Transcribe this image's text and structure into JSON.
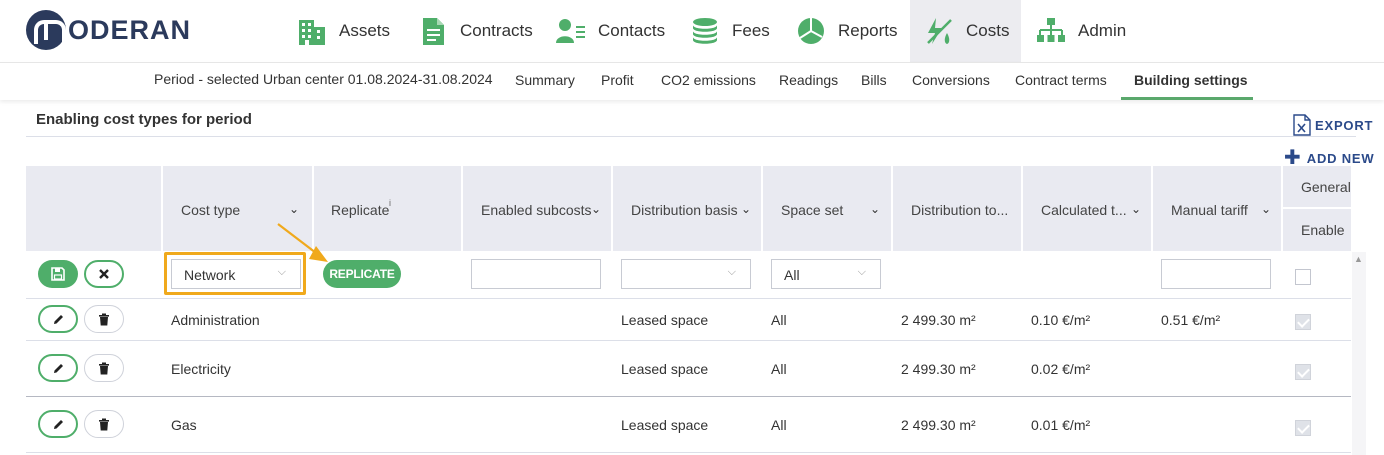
{
  "brand": {
    "logo_text": "ODERAN"
  },
  "nav": {
    "items": [
      {
        "label": "Assets",
        "icon": "building-icon"
      },
      {
        "label": "Contracts",
        "icon": "document-icon"
      },
      {
        "label": "Contacts",
        "icon": "contacts-icon"
      },
      {
        "label": "Fees",
        "icon": "coins-icon"
      },
      {
        "label": "Reports",
        "icon": "pie-chart-icon"
      },
      {
        "label": "Costs",
        "icon": "costs-icon",
        "active": true
      },
      {
        "label": "Admin",
        "icon": "org-chart-icon"
      }
    ]
  },
  "subnav": {
    "period": "Period - selected Urban center 01.08.2024-31.08.2024",
    "tabs": [
      {
        "label": "Summary"
      },
      {
        "label": "Profit"
      },
      {
        "label": "CO2 emissions"
      },
      {
        "label": "Readings"
      },
      {
        "label": "Bills"
      },
      {
        "label": "Conversions"
      },
      {
        "label": "Contract terms"
      },
      {
        "label": "Building settings",
        "active": true
      }
    ]
  },
  "section": {
    "title": "Enabling cost types for period",
    "export_label": "EXPORT",
    "add_new_label": "ADD NEW"
  },
  "table": {
    "columns": {
      "cost_type": "Cost type",
      "replicate": "Replicate",
      "replicate_info": "i",
      "enabled_subcosts": "Enabled subcosts",
      "distribution_basis": "Distribution basis",
      "space_set": "Space set",
      "distribution_total": "Distribution to...",
      "calculated_tariff": "Calculated t...",
      "manual_tariff": "Manual tariff",
      "general": "General",
      "enable": "Enable"
    },
    "edit_row": {
      "cost_type_value": "Network",
      "replicate_button": "REPLICATE",
      "enabled_subcosts_value": "",
      "distribution_basis_value": "",
      "space_set_value": "All",
      "manual_tariff_value": "",
      "enable_checked": false
    },
    "rows": [
      {
        "cost_type": "Administration",
        "distribution_basis": "Leased space",
        "space_set": "All",
        "distribution_total": "2 499.30 m²",
        "calculated_tariff": "0.10 €/m²",
        "manual_tariff": "0.51 €/m²",
        "enabled": true
      },
      {
        "cost_type": "Electricity",
        "distribution_basis": "Leased space",
        "space_set": "All",
        "distribution_total": "2 499.30 m²",
        "calculated_tariff": "0.02 €/m²",
        "manual_tariff": "",
        "enabled": true
      },
      {
        "cost_type": "Gas",
        "distribution_basis": "Leased space",
        "space_set": "All",
        "distribution_total": "2 499.30 m²",
        "calculated_tariff": "0.01 €/m²",
        "manual_tariff": "",
        "enabled": true
      }
    ]
  },
  "colors": {
    "accent_green": "#4fae6a",
    "brand_navy": "#2b3a5c",
    "highlight_orange": "#f0a91c",
    "link_blue": "#2b4a8a",
    "header_bg": "#e9eaf1"
  }
}
